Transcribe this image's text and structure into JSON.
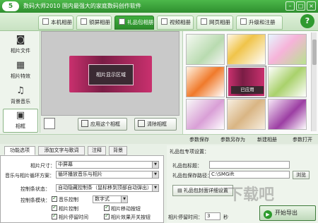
{
  "titlebar": {
    "logo": "5",
    "title": "数码大师2010    国内最强大的家庭数码创作软件"
  },
  "main_tabs": [
    {
      "label": "本机相册"
    },
    {
      "label": "锁屏相册"
    },
    {
      "label": "礼品包相册"
    },
    {
      "label": "视频相册"
    },
    {
      "label": "网页相册"
    },
    {
      "label": "升级和注册"
    }
  ],
  "help": "?",
  "leftnav": [
    {
      "label": "相片文件",
      "icon": "camera-icon"
    },
    {
      "label": "相片特效",
      "icon": "effects-icon"
    },
    {
      "label": "背景音乐",
      "icon": "music-icon"
    },
    {
      "label": "相框",
      "icon": "frame-icon"
    }
  ],
  "preview": {
    "display_label": "相片显示区域"
  },
  "preview_buttons": {
    "apply": "应用这个相框",
    "clear": "清除相框"
  },
  "gallery": {
    "applied_badge": "已应用"
  },
  "params_bar": {
    "save": "参数保存",
    "save_as": "参数另存为",
    "new": "新建相册",
    "open": "参数打开"
  },
  "panel_tabs": [
    "功能选项",
    "添加文字与歌词",
    "注释",
    "背景"
  ],
  "options": {
    "size_label": "相片尺寸：",
    "size_value": "中屏幕",
    "music_label": "音乐与相片循环方案：",
    "music_value": "循环播放音乐与相片",
    "control_label": "控制条状态：",
    "control_value": "自动隐藏控制条（鼠标移到顶部自动弹出）",
    "module_label": "控制条模块：",
    "checks": [
      "音乐控制",
      "数字式",
      "相片控制",
      "相片移动按钮",
      "相片停留时间",
      "相片效果开关按钮"
    ]
  },
  "gift": {
    "title": "礼品包专项设置：",
    "title_label": "礼品包标题：",
    "title_value": "",
    "path_label": "礼品包保存路径：",
    "path_value": "C:\\SMGift",
    "browse": "浏览",
    "advanced": "礼品包封面详细设置",
    "stay_label": "相片停留时间：",
    "stay_value": "3",
    "stay_unit": "秒",
    "export": "开始导出"
  },
  "watermark": "下载吧"
}
